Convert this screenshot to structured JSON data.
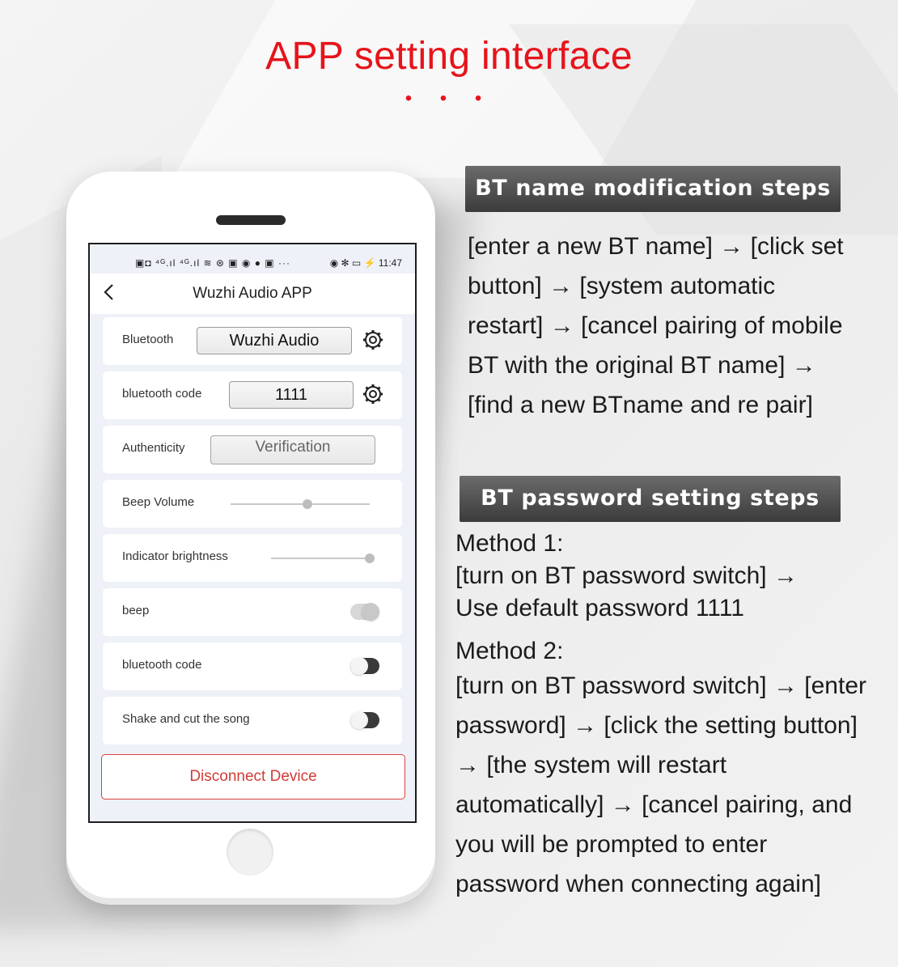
{
  "page": {
    "title": "APP setting interface",
    "dots": "• • •"
  },
  "phone": {
    "status_left": "▣◘ ⁴ᴳ.ıl ⁴ᴳ.ıl ≋ ⊛ ▣ ◉ ● ▣ ···",
    "status_right": "◉ ✻ ▭ ⚡ 11:47",
    "app_title": "Wuzhi Audio APP",
    "rows": {
      "bluetooth_label": "Bluetooth",
      "bluetooth_value": "Wuzhi Audio",
      "code_label": "bluetooth code",
      "code_value": "1111",
      "auth_label": "Authenticity",
      "auth_button": "Verification",
      "beep_volume_label": "Beep Volume",
      "beep_volume_level": 0.55,
      "indicator_label": "Indicator brightness",
      "indicator_level": 1.0,
      "beep_label": "beep",
      "beep_on": true,
      "bt_code_toggle_label": "bluetooth code",
      "bt_code_on": false,
      "shake_label": "Shake and cut the song",
      "shake_on": false
    },
    "disconnect": "Disconnect Device"
  },
  "sections": {
    "bt_name_heading": "BT name modification steps",
    "bt_name_steps": "[enter a new BT name] → [click set button] → [system automatic restart] → [cancel pairing of mobile BT with the original BT name] → [find a new BTname and re pair]",
    "bt_password_heading": "BT password setting steps",
    "method1_title": "Method 1:",
    "method1_line1": "[turn on BT password switch] →",
    "method1_line2": "Use default password 1111",
    "method2_title": "Method 2:",
    "method2_steps": "[turn on BT password switch] → [enter password] → [click the setting button] → [the system will restart automatically] → [cancel pairing, and you will be prompted to enter password when connecting again]"
  },
  "colors": {
    "title_red": "#e6141b",
    "disconnect_red": "#d23b36",
    "heading_gray": "#4a4a4a"
  }
}
